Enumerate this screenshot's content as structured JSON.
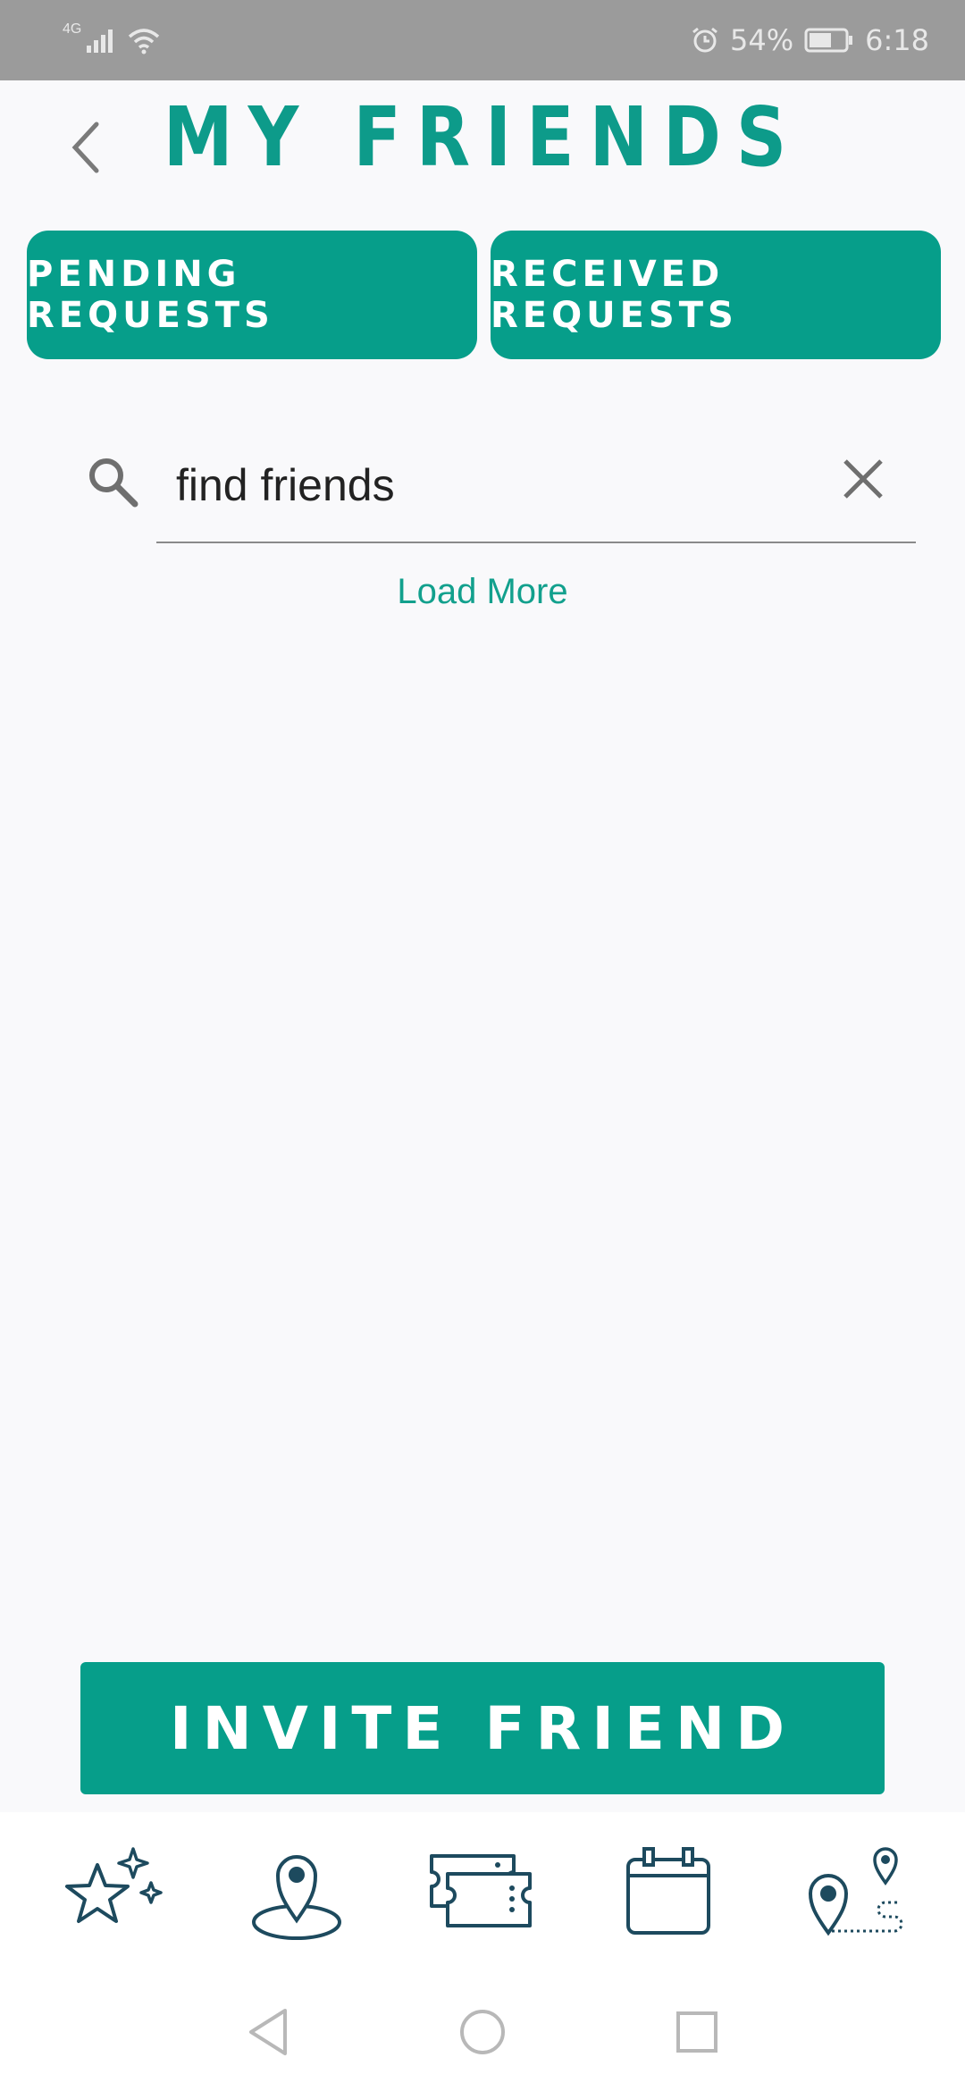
{
  "status": {
    "network": "4G",
    "battery": "54%",
    "time": "6:18"
  },
  "header": {
    "title": "MY FRIENDS"
  },
  "requests": {
    "pending_label": "PENDING REQUESTS",
    "received_label": "RECEIVED REQUESTS"
  },
  "search": {
    "value": "find friends"
  },
  "list": {
    "load_more_label": "Load More"
  },
  "invite": {
    "label": "INVITE FRIEND"
  },
  "bottom_nav": {
    "items": [
      {
        "icon": "stars-icon"
      },
      {
        "icon": "location-pin-icon"
      },
      {
        "icon": "tickets-icon"
      },
      {
        "icon": "calendar-icon"
      },
      {
        "icon": "route-icon"
      }
    ]
  },
  "colors": {
    "accent": "#069e8a",
    "title": "#0d9b8a",
    "nav_icon": "#1d4a5e"
  }
}
